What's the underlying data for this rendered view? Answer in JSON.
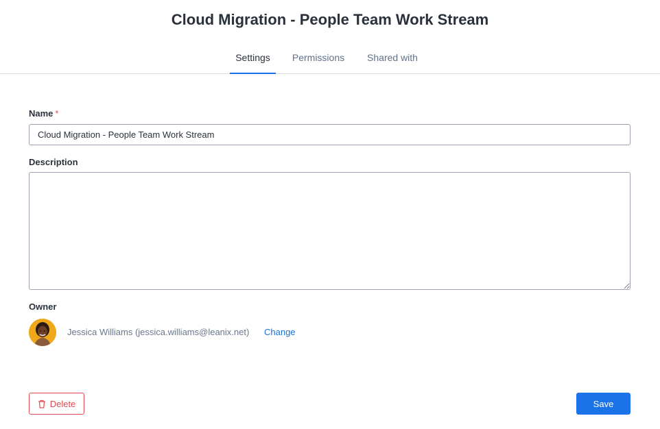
{
  "page": {
    "title": "Cloud Migration - People Team Work Stream"
  },
  "tabs": [
    {
      "label": "Settings",
      "active": true
    },
    {
      "label": "Permissions",
      "active": false
    },
    {
      "label": "Shared with",
      "active": false
    }
  ],
  "form": {
    "name_label": "Name",
    "required_marker": "*",
    "name_value": "Cloud Migration - People Team Work Stream",
    "description_label": "Description",
    "description_value": "",
    "owner_label": "Owner",
    "owner_text": "Jessica Williams (jessica.williams@leanix.net)",
    "change_label": "Change"
  },
  "actions": {
    "delete_label": "Delete",
    "delete_icon": "trash-icon",
    "save_label": "Save"
  },
  "colors": {
    "accent": "#1a73e8",
    "danger": "#e34850",
    "avatar_bg": "#f0a81b"
  }
}
